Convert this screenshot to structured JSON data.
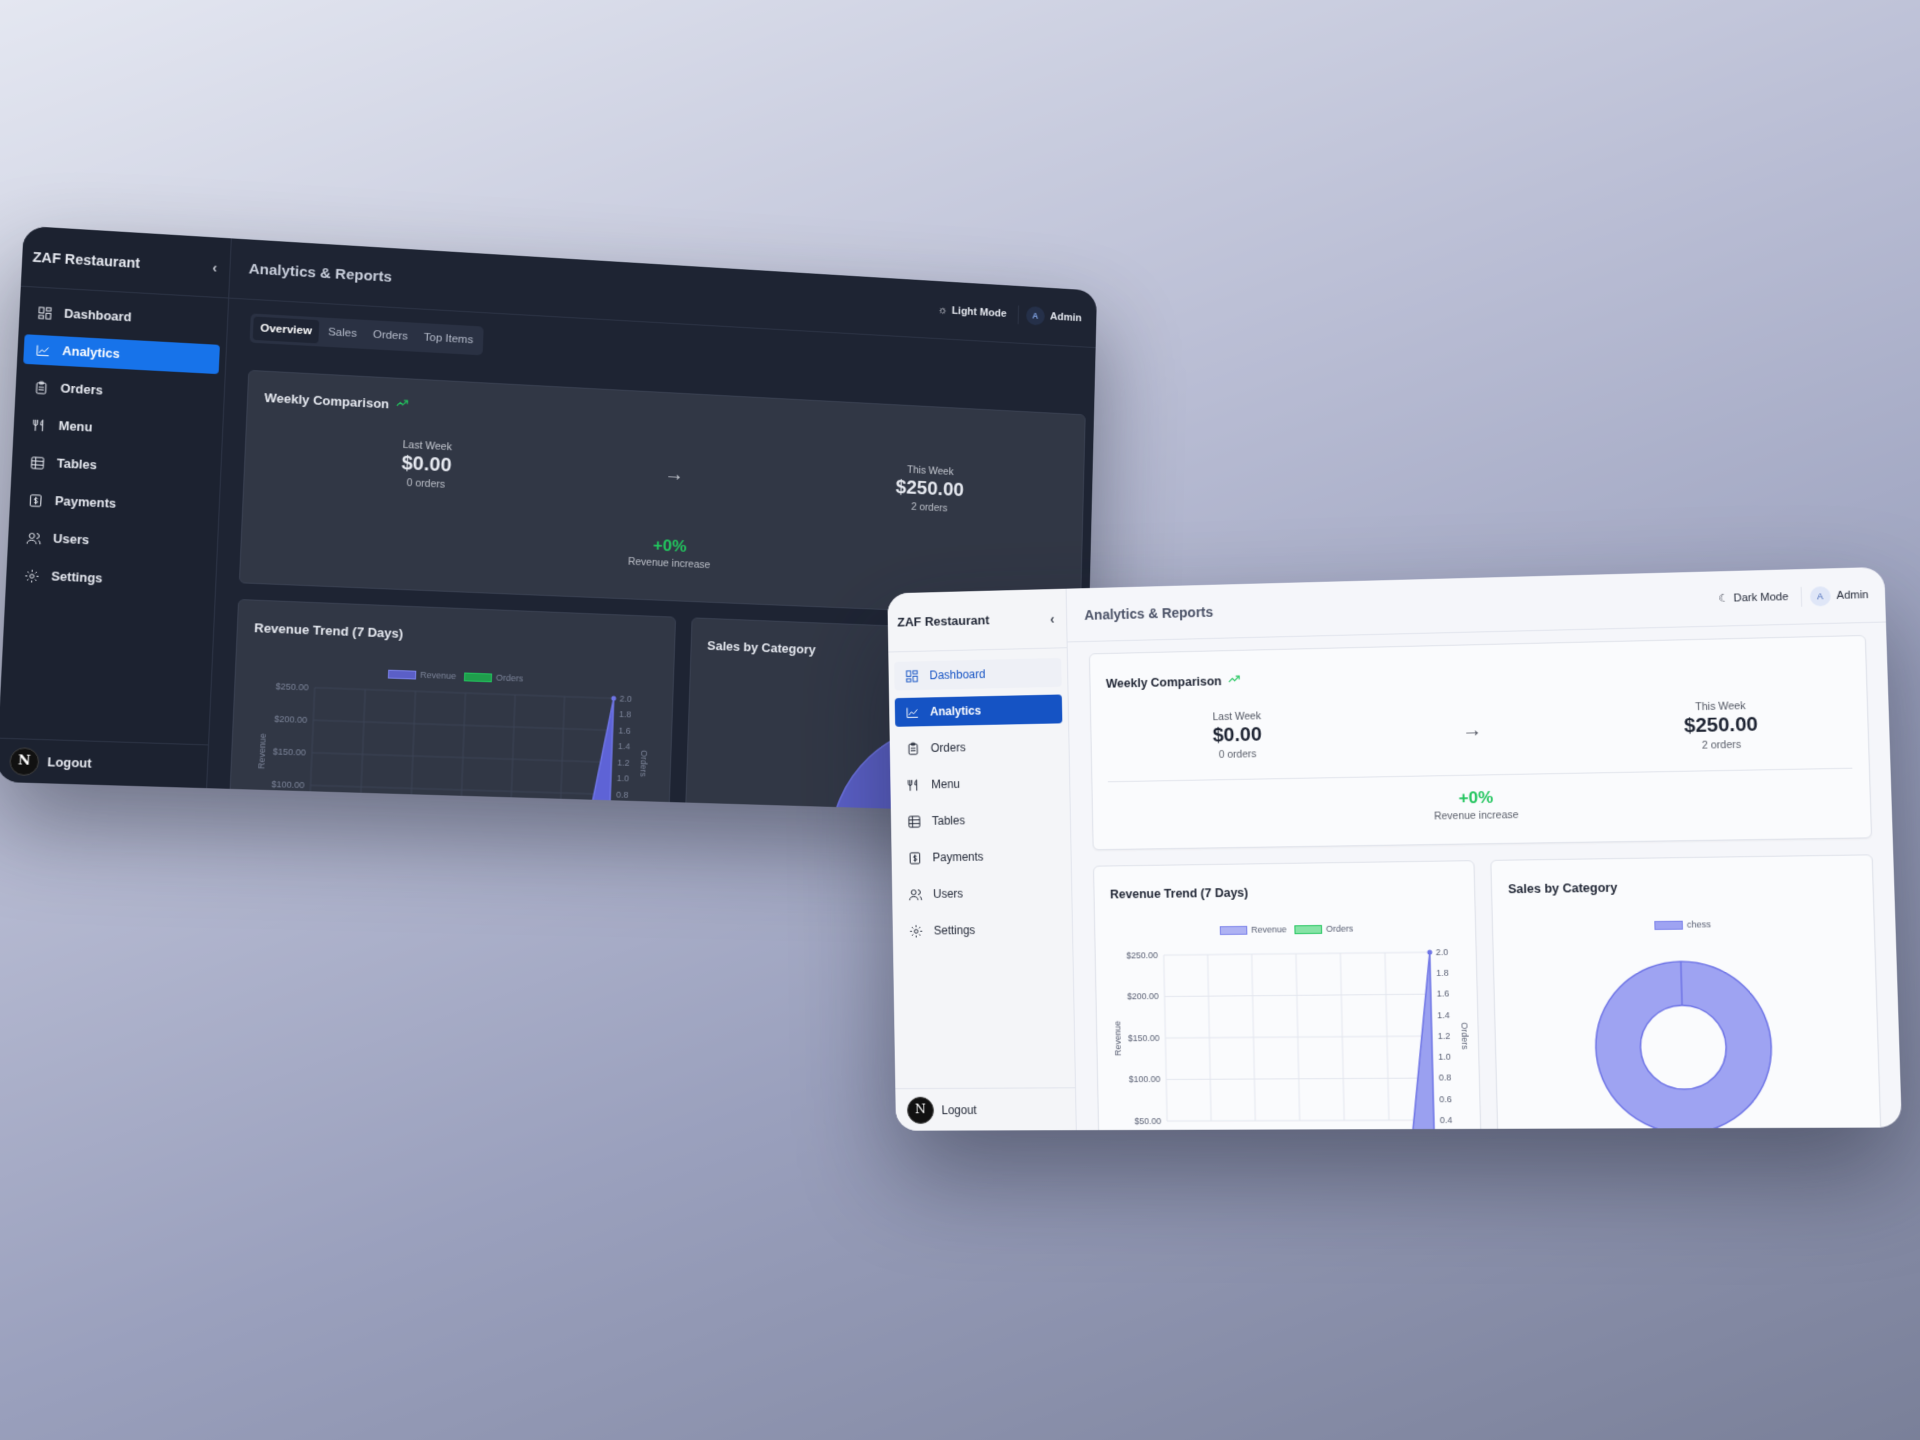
{
  "app": {
    "brand": "ZAF Restaurant",
    "page_title": "Analytics & Reports"
  },
  "nav": [
    {
      "label": "Dashboard",
      "icon": "dashboard-icon"
    },
    {
      "label": "Analytics",
      "icon": "analytics-icon"
    },
    {
      "label": "Orders",
      "icon": "clipboard-icon"
    },
    {
      "label": "Menu",
      "icon": "utensils-icon"
    },
    {
      "label": "Tables",
      "icon": "table-icon"
    },
    {
      "label": "Payments",
      "icon": "dollar-icon"
    },
    {
      "label": "Users",
      "icon": "users-icon"
    },
    {
      "label": "Settings",
      "icon": "gear-icon"
    }
  ],
  "logout_label": "Logout",
  "n_badge": "N",
  "user": {
    "avatar": "A",
    "name": "Admin"
  },
  "dark": {
    "mode_toggle": "Light Mode"
  },
  "light": {
    "mode_toggle": "Dark Mode"
  },
  "tabs": [
    "Overview",
    "Sales",
    "Orders",
    "Top Items"
  ],
  "weekly": {
    "title": "Weekly Comparison",
    "last_label": "Last Week",
    "last_value": "$0.00",
    "last_orders": "0 orders",
    "this_label": "This Week",
    "this_value": "$250.00",
    "this_orders": "2 orders",
    "change": "+0%",
    "change_label": "Revenue increase"
  },
  "revenue_card": {
    "title": "Revenue Trend (7 Days)"
  },
  "category_card": {
    "title": "Sales by Category"
  },
  "colors": {
    "accent_dark": "#1773ea",
    "accent_light": "#1553c4",
    "revenue": "#7b82ea",
    "orders": "#22c55e",
    "positive": "#22c55e"
  },
  "chart_data": [
    {
      "type": "line",
      "title": "Revenue Trend (7 Days)",
      "series": [
        {
          "name": "Revenue",
          "values": [
            0,
            0,
            0,
            0,
            0,
            0,
            250
          ]
        },
        {
          "name": "Orders",
          "values": [
            0,
            0,
            0,
            0,
            0,
            0,
            2
          ]
        }
      ],
      "ylabel": "Revenue",
      "y2label": "Orders",
      "y_ticks": [
        "$250.00",
        "$200.00",
        "$150.00",
        "$100.00",
        "$50.00"
      ],
      "y2_ticks": [
        "2.0",
        "1.8",
        "1.6",
        "1.4",
        "1.2",
        "1.0",
        "0.8",
        "0.6",
        "0.4"
      ],
      "ylim": [
        0,
        250
      ],
      "y2lim": [
        0,
        2
      ],
      "legend": "top-center",
      "grid": true
    },
    {
      "type": "pie",
      "title": "Sales by Category",
      "categories": [
        "chess"
      ],
      "values": [
        100
      ],
      "legend": "top-center"
    }
  ]
}
